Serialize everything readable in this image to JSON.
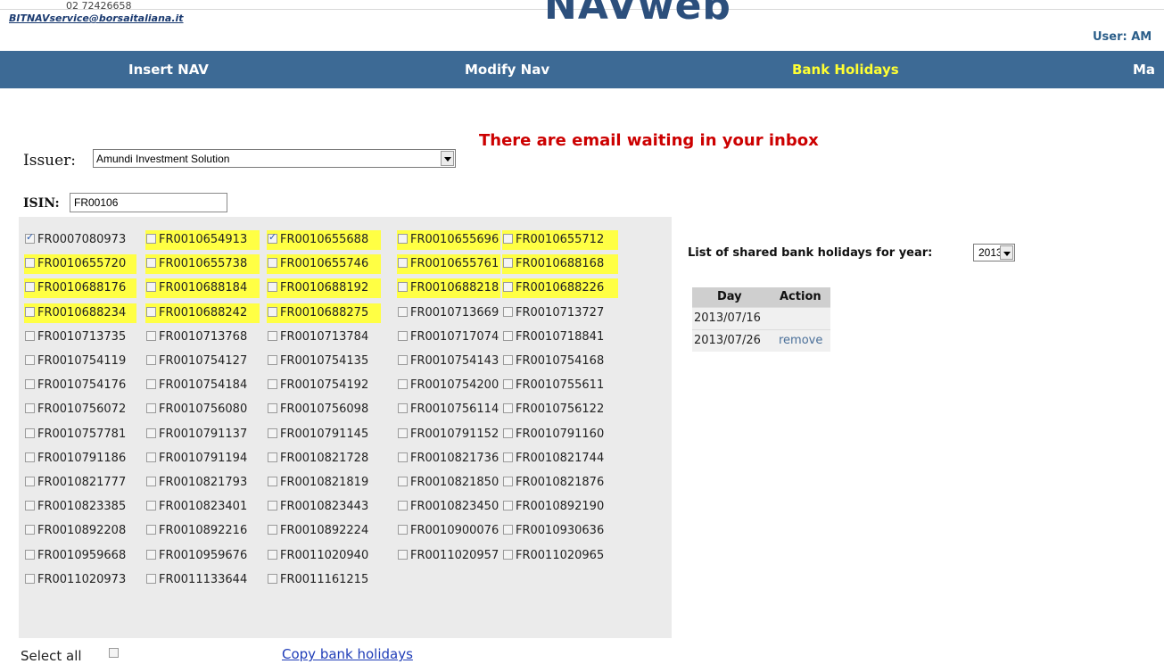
{
  "header": {
    "phone": "02 72426658",
    "service_email": "BITNAVservice@borsaitaliana.it",
    "logo": "NAVweb",
    "user": "User: AM"
  },
  "nav": [
    {
      "label": "Insert NAV",
      "active": false
    },
    {
      "label": "Modify Nav",
      "active": false
    },
    {
      "label": "Bank Holidays",
      "active": true
    },
    {
      "label": "Ma",
      "active": false
    }
  ],
  "alert": "There are email waiting in your inbox",
  "issuer": {
    "label": "Issuer:",
    "selected": "Amundi Investment Solution"
  },
  "isin_filter": {
    "label": "ISIN:",
    "value": "FR00106"
  },
  "isins": [
    {
      "code": "FR0007080973",
      "checked": true,
      "highlight": false
    },
    {
      "code": "FR0010654913",
      "checked": false,
      "highlight": true
    },
    {
      "code": "FR0010655688",
      "checked": true,
      "highlight": true
    },
    {
      "code": "FR0010655696",
      "checked": false,
      "highlight": true
    },
    {
      "code": "FR0010655712",
      "checked": false,
      "highlight": true
    },
    {
      "code": "FR0010655720",
      "checked": false,
      "highlight": true
    },
    {
      "code": "FR0010655738",
      "checked": false,
      "highlight": true
    },
    {
      "code": "FR0010655746",
      "checked": false,
      "highlight": true
    },
    {
      "code": "FR0010655761",
      "checked": false,
      "highlight": true
    },
    {
      "code": "FR0010688168",
      "checked": false,
      "highlight": true
    },
    {
      "code": "FR0010688176",
      "checked": false,
      "highlight": true
    },
    {
      "code": "FR0010688184",
      "checked": false,
      "highlight": true
    },
    {
      "code": "FR0010688192",
      "checked": false,
      "highlight": true
    },
    {
      "code": "FR0010688218",
      "checked": false,
      "highlight": true
    },
    {
      "code": "FR0010688226",
      "checked": false,
      "highlight": true
    },
    {
      "code": "FR0010688234",
      "checked": false,
      "highlight": true
    },
    {
      "code": "FR0010688242",
      "checked": false,
      "highlight": true
    },
    {
      "code": "FR0010688275",
      "checked": false,
      "highlight": true
    },
    {
      "code": "FR0010713669",
      "checked": false,
      "highlight": false
    },
    {
      "code": "FR0010713727",
      "checked": false,
      "highlight": false
    },
    {
      "code": "FR0010713735",
      "checked": false,
      "highlight": false
    },
    {
      "code": "FR0010713768",
      "checked": false,
      "highlight": false
    },
    {
      "code": "FR0010713784",
      "checked": false,
      "highlight": false
    },
    {
      "code": "FR0010717074",
      "checked": false,
      "highlight": false
    },
    {
      "code": "FR0010718841",
      "checked": false,
      "highlight": false
    },
    {
      "code": "FR0010754119",
      "checked": false,
      "highlight": false
    },
    {
      "code": "FR0010754127",
      "checked": false,
      "highlight": false
    },
    {
      "code": "FR0010754135",
      "checked": false,
      "highlight": false
    },
    {
      "code": "FR0010754143",
      "checked": false,
      "highlight": false
    },
    {
      "code": "FR0010754168",
      "checked": false,
      "highlight": false
    },
    {
      "code": "FR0010754176",
      "checked": false,
      "highlight": false
    },
    {
      "code": "FR0010754184",
      "checked": false,
      "highlight": false
    },
    {
      "code": "FR0010754192",
      "checked": false,
      "highlight": false
    },
    {
      "code": "FR0010754200",
      "checked": false,
      "highlight": false
    },
    {
      "code": "FR0010755611",
      "checked": false,
      "highlight": false
    },
    {
      "code": "FR0010756072",
      "checked": false,
      "highlight": false
    },
    {
      "code": "FR0010756080",
      "checked": false,
      "highlight": false
    },
    {
      "code": "FR0010756098",
      "checked": false,
      "highlight": false
    },
    {
      "code": "FR0010756114",
      "checked": false,
      "highlight": false
    },
    {
      "code": "FR0010756122",
      "checked": false,
      "highlight": false
    },
    {
      "code": "FR0010757781",
      "checked": false,
      "highlight": false
    },
    {
      "code": "FR0010791137",
      "checked": false,
      "highlight": false
    },
    {
      "code": "FR0010791145",
      "checked": false,
      "highlight": false
    },
    {
      "code": "FR0010791152",
      "checked": false,
      "highlight": false
    },
    {
      "code": "FR0010791160",
      "checked": false,
      "highlight": false
    },
    {
      "code": "FR0010791186",
      "checked": false,
      "highlight": false
    },
    {
      "code": "FR0010791194",
      "checked": false,
      "highlight": false
    },
    {
      "code": "FR0010821728",
      "checked": false,
      "highlight": false
    },
    {
      "code": "FR0010821736",
      "checked": false,
      "highlight": false
    },
    {
      "code": "FR0010821744",
      "checked": false,
      "highlight": false
    },
    {
      "code": "FR0010821777",
      "checked": false,
      "highlight": false
    },
    {
      "code": "FR0010821793",
      "checked": false,
      "highlight": false
    },
    {
      "code": "FR0010821819",
      "checked": false,
      "highlight": false
    },
    {
      "code": "FR0010821850",
      "checked": false,
      "highlight": false
    },
    {
      "code": "FR0010821876",
      "checked": false,
      "highlight": false
    },
    {
      "code": "FR0010823385",
      "checked": false,
      "highlight": false
    },
    {
      "code": "FR0010823401",
      "checked": false,
      "highlight": false
    },
    {
      "code": "FR0010823443",
      "checked": false,
      "highlight": false
    },
    {
      "code": "FR0010823450",
      "checked": false,
      "highlight": false
    },
    {
      "code": "FR0010892190",
      "checked": false,
      "highlight": false
    },
    {
      "code": "FR0010892208",
      "checked": false,
      "highlight": false
    },
    {
      "code": "FR0010892216",
      "checked": false,
      "highlight": false
    },
    {
      "code": "FR0010892224",
      "checked": false,
      "highlight": false
    },
    {
      "code": "FR0010900076",
      "checked": false,
      "highlight": false
    },
    {
      "code": "FR0010930636",
      "checked": false,
      "highlight": false
    },
    {
      "code": "FR0010959668",
      "checked": false,
      "highlight": false
    },
    {
      "code": "FR0010959676",
      "checked": false,
      "highlight": false
    },
    {
      "code": "FR0011020940",
      "checked": false,
      "highlight": false
    },
    {
      "code": "FR0011020957",
      "checked": false,
      "highlight": false
    },
    {
      "code": "FR0011020965",
      "checked": false,
      "highlight": false
    },
    {
      "code": "FR0011020973",
      "checked": false,
      "highlight": false
    },
    {
      "code": "FR0011133644",
      "checked": false,
      "highlight": false
    },
    {
      "code": "FR0011161215",
      "checked": false,
      "highlight": false
    }
  ],
  "holidays_panel": {
    "label": "List of shared bank holidays  for year:",
    "year": "2013",
    "columns": [
      "Day",
      "Action"
    ],
    "rows": [
      {
        "day": "2013/07/16",
        "action": ""
      },
      {
        "day": "2013/07/26",
        "action": "remove"
      }
    ]
  },
  "footer": {
    "select_all": "Select all",
    "copy_link": "Copy bank holidays"
  },
  "colors": {
    "navbar": "#3d6a95",
    "nav_active": "#ffff33",
    "highlight": "#ffff44",
    "alert": "#cc0000"
  }
}
